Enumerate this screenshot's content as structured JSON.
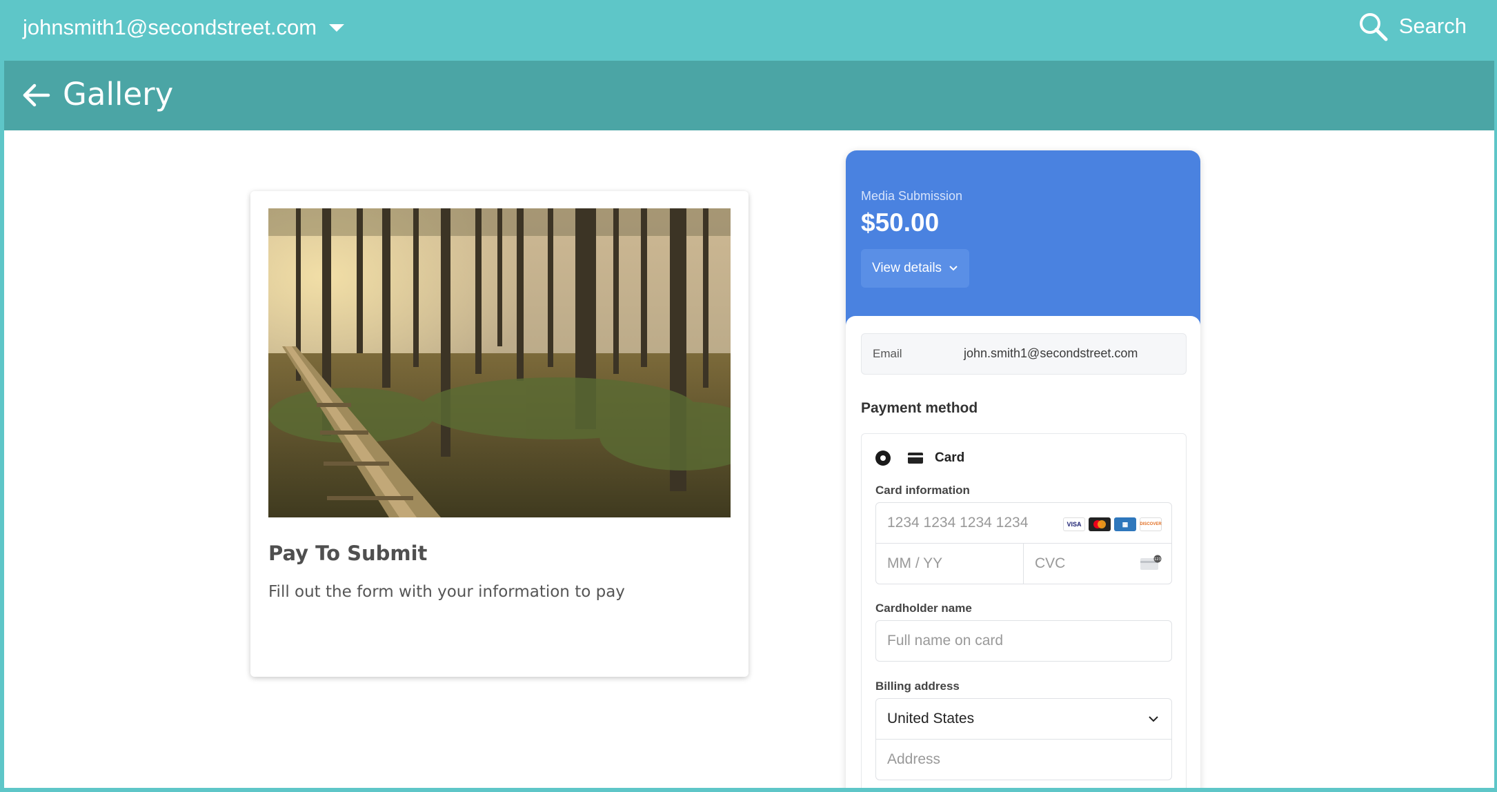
{
  "topbar": {
    "account_email": "johnsmith1@secondstreet.com",
    "search_label": "Search"
  },
  "subheader": {
    "title": "Gallery"
  },
  "card": {
    "title": "Pay To Submit",
    "description": "Fill out the form with your information to pay",
    "image_alt": "Wooden boardwalk through a misty pine forest"
  },
  "checkout": {
    "product": "Media Submission",
    "price": "$50.00",
    "view_details_label": "View details",
    "email_label": "Email",
    "email_value": "john.smith1@secondstreet.com",
    "payment_method_label": "Payment method",
    "card_option_label": "Card",
    "card_info_label": "Card information",
    "card_number_placeholder": "1234 1234 1234 1234",
    "expiry_placeholder": "MM / YY",
    "cvc_placeholder": "CVC",
    "cardholder_label": "Cardholder name",
    "cardholder_placeholder": "Full name on card",
    "billing_label": "Billing address",
    "country_value": "United States",
    "address_placeholder": "Address",
    "brands": [
      "VISA",
      "MC",
      "AMEX",
      "DISCOVER"
    ]
  },
  "colors": {
    "topbar": "#5ec6c8",
    "subheader": "#4ba5a5",
    "checkout_header": "#4a82e0"
  }
}
